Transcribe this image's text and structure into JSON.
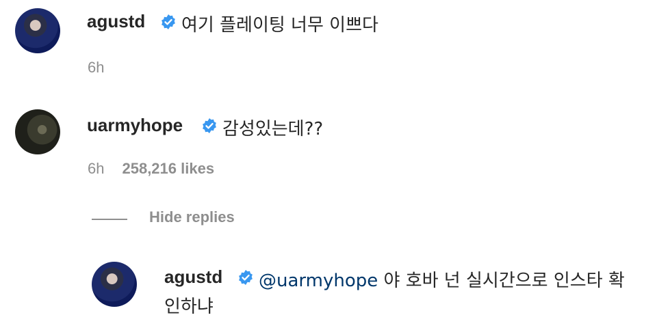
{
  "comments": [
    {
      "username": "agustd",
      "text": "여기 플레이팅 너무 이쁘다",
      "time": "6h",
      "likes": ""
    },
    {
      "username": "uarmyhope",
      "text": "감성있는데??",
      "time": "6h",
      "likes": "258,216 likes"
    }
  ],
  "hide_replies_label": "Hide replies",
  "reply": {
    "username": "agustd",
    "mention": "@uarmyhope",
    "text_line1": " 야 호바 넌 실시간으로 인스타 확",
    "text_line2": "인하냐"
  },
  "colors": {
    "verified": "#3897f0",
    "mention": "#00376b",
    "meta": "#8e8e8e"
  },
  "icons": [
    "verified-badge-icon"
  ]
}
